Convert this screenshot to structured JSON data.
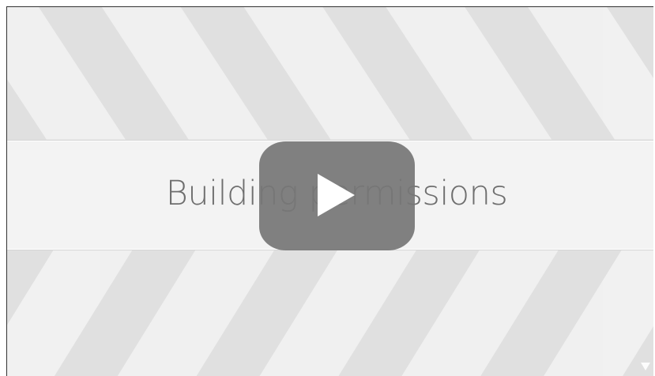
{
  "video": {
    "title": "Building permissions",
    "play_icon": "play-icon",
    "corner_icon": "expand-triangle-icon"
  },
  "colors": {
    "background": "#e3e3e3",
    "stripe": "#f1f1f1",
    "band": "#f3f3f3",
    "title_text": "#6e6e6e",
    "play_button": "#767676",
    "play_glyph": "#ffffff"
  }
}
